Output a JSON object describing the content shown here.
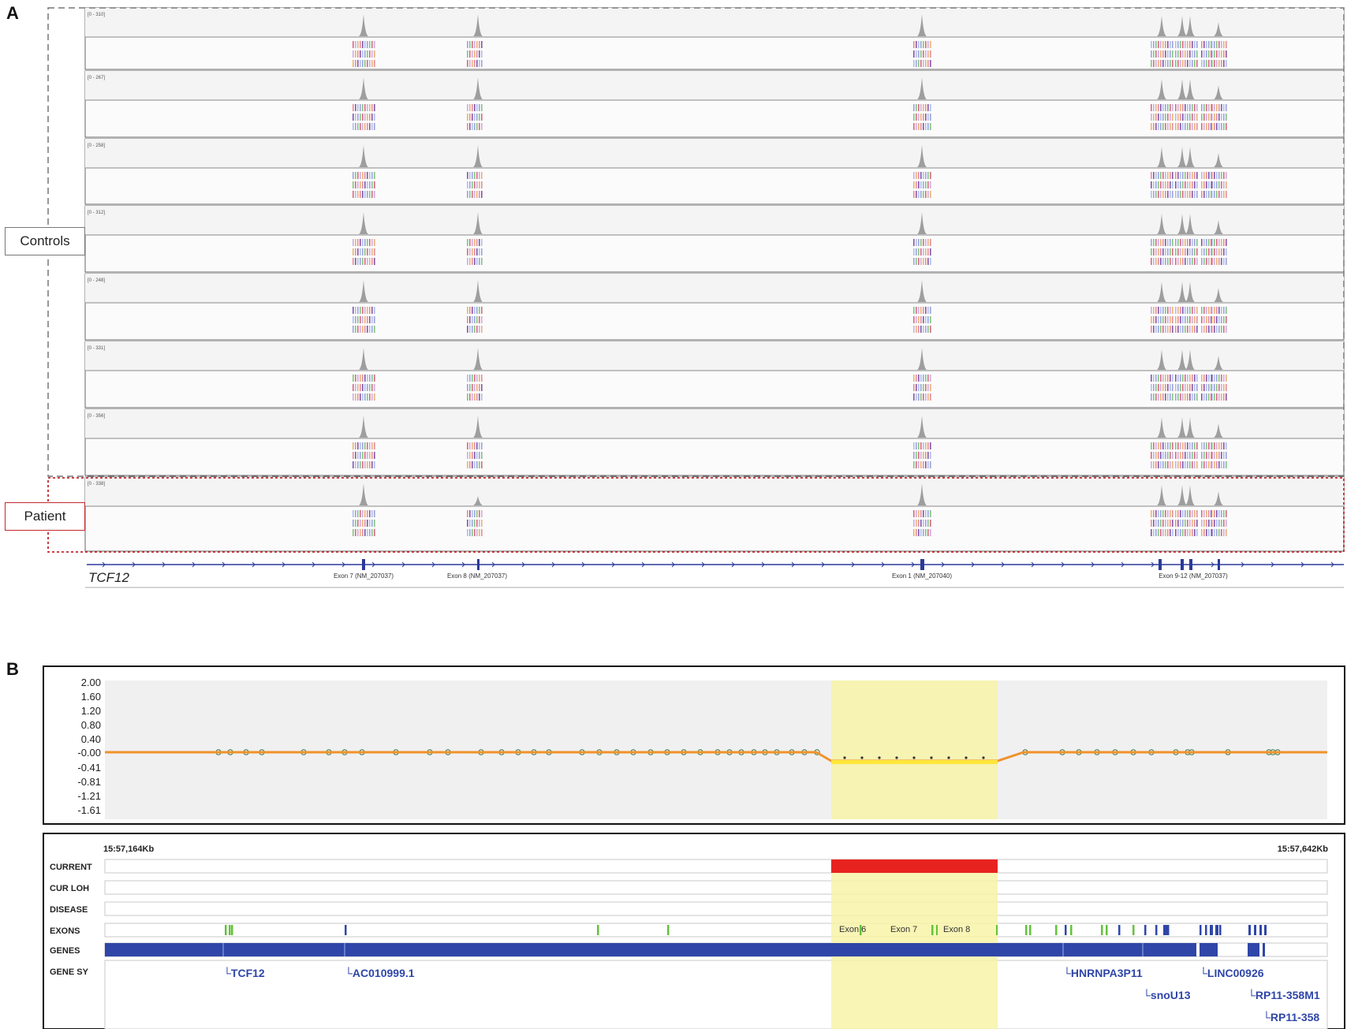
{
  "panelA": {
    "label": "A",
    "controls_label": "Controls",
    "patient_label": "Patient",
    "tracks": [
      {
        "range": "[0 - 310]",
        "group": "control"
      },
      {
        "range": "[0 - 267]",
        "group": "control"
      },
      {
        "range": "[0 - 258]",
        "group": "control"
      },
      {
        "range": "[0 - 312]",
        "group": "control"
      },
      {
        "range": "[0 - 248]",
        "group": "control"
      },
      {
        "range": "[0 - 331]",
        "group": "control"
      },
      {
        "range": "[0 - 356]",
        "group": "control"
      },
      {
        "range": "[0 - 338]",
        "group": "patient"
      }
    ],
    "gene_name": "TCF12",
    "exon_labels": [
      "Exon 7 (NM_207037)",
      "Exon 8 (NM_207037)",
      "Exon 1 (NM_207040)",
      "Exon 9-12 (NM_207037)"
    ],
    "colors": {
      "coverage": "#9e9e9e",
      "gene": "#2b3a9a",
      "controls_border": "#777777",
      "patient_border": "#c0282d"
    }
  },
  "panelB": {
    "label": "B",
    "y_ticks": [
      "2.00",
      "1.60",
      "1.20",
      "0.80",
      "0.40",
      "-0.00",
      "-0.41",
      "-0.81",
      "-1.21",
      "-1.61"
    ],
    "coord_start": "15:57,164Kb",
    "coord_end": "15:57,642Kb",
    "row_labels": [
      "CURRENT",
      "CUR LOH",
      "DISEASE",
      "EXONS",
      "GENES",
      "GENE SY"
    ],
    "exon_labels": [
      "Exon 6",
      "Exon 7",
      "Exon 8"
    ],
    "gene_symbols": [
      "TCF12",
      "AC010999.1",
      "HNRNPA3P11",
      "snoU13",
      "LINC00926",
      "RP11-358M1",
      "RP11-358"
    ],
    "colors": {
      "line": "#f0922b",
      "highlight": "#f7f3a8",
      "deletion": "#e8231f",
      "genes": "#2f46a8",
      "exons_green": "#63c23a"
    }
  }
}
